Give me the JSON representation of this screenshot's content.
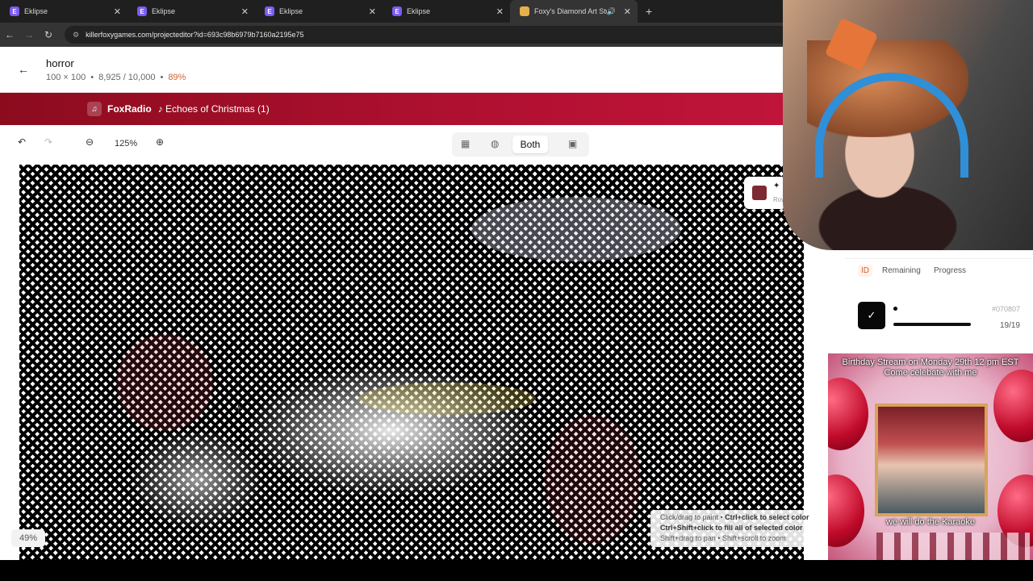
{
  "browser": {
    "tabs": [
      {
        "title": "Eklipse",
        "active": false
      },
      {
        "title": "Eklipse",
        "active": false
      },
      {
        "title": "Eklipse",
        "active": false
      },
      {
        "title": "Eklipse",
        "active": false
      },
      {
        "title": "Foxy's Diamond Art Studio",
        "active": true
      }
    ],
    "url": "killerfoxygames.com/projecteditor?id=693c98b6979b7160a2195e75"
  },
  "project": {
    "title": "horror",
    "size": "100 × 100",
    "progress_count": "8,925 / 10,000",
    "progress_pct": "89%"
  },
  "radio": {
    "name": "FoxRadio",
    "track": "♪ Echoes of Christmas (1)"
  },
  "toolbar": {
    "zoom": "125%",
    "view_mode": "Both"
  },
  "canvas": {
    "progress_value": 0.49,
    "progress_label": "49%",
    "hint_line1_a": "Click/drag to paint • ",
    "hint_line1_b": "Ctrl+click to select color",
    "hint_line2": "Ctrl+Shift+click to fill all of selected color",
    "hint_line3": "Shift+drag to pan • Shift+scroll to zoom"
  },
  "selected_color": {
    "hex": "#7e2a32",
    "row_label": "Row"
  },
  "side_panel": {
    "tabs": [
      "ID",
      "Remaining",
      "Progress"
    ],
    "active_tab": "ID",
    "palette": [
      {
        "id": "#070807",
        "count": "19/19",
        "color": "#070807",
        "done": true
      }
    ]
  },
  "promo": {
    "line1": "Birthday Stream on Monday 29th 12 pm EST",
    "line2": "Come celebate with me",
    "line3": "we will do the Karaoke"
  }
}
